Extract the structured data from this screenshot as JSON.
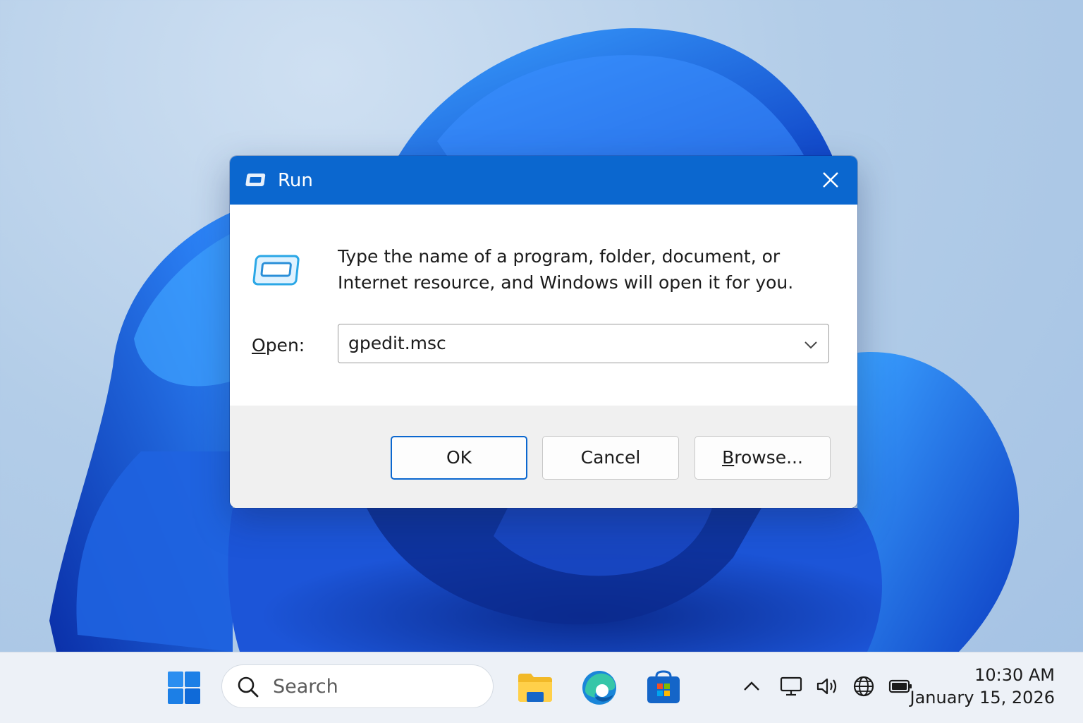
{
  "dialog": {
    "title": "Run",
    "description": "Type the name of a program, folder, document, or Internet resource, and Windows will open it for you.",
    "open_label_accel": "O",
    "open_label_rest": "pen:",
    "open_value": "gpedit.msc",
    "ok_label": "OK",
    "cancel_label": "Cancel",
    "browse_accel": "B",
    "browse_rest": "rowse...",
    "close_icon": "close-icon"
  },
  "taskbar": {
    "search_placeholder": "Search",
    "apps": [
      "start-icon",
      "file-explorer-icon",
      "edge-icon",
      "microsoft-store-icon"
    ],
    "tray": [
      "chevron-up-icon",
      "display-icon",
      "volume-icon",
      "globe-icon",
      "battery-icon"
    ],
    "time": "10:30 AM",
    "date": "January 15, 2026"
  },
  "colors": {
    "titlebar": "#0b67cf",
    "accent": "#0b67cf",
    "wallpaper_bloom": "#1f63e0"
  }
}
